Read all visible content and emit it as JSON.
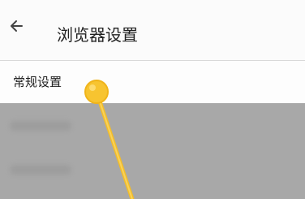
{
  "header": {
    "title": "浏览器设置",
    "back_icon": "arrow-left-icon"
  },
  "settings": {
    "general_label": "常规设置"
  },
  "gesture": {
    "type": "tap-drag-indicator",
    "color": "#f7c430",
    "icon": "touch-point-icon"
  },
  "colors": {
    "overlay": "#a8a8a8",
    "header_bg": "#fbfbfb",
    "text": "#222222"
  }
}
